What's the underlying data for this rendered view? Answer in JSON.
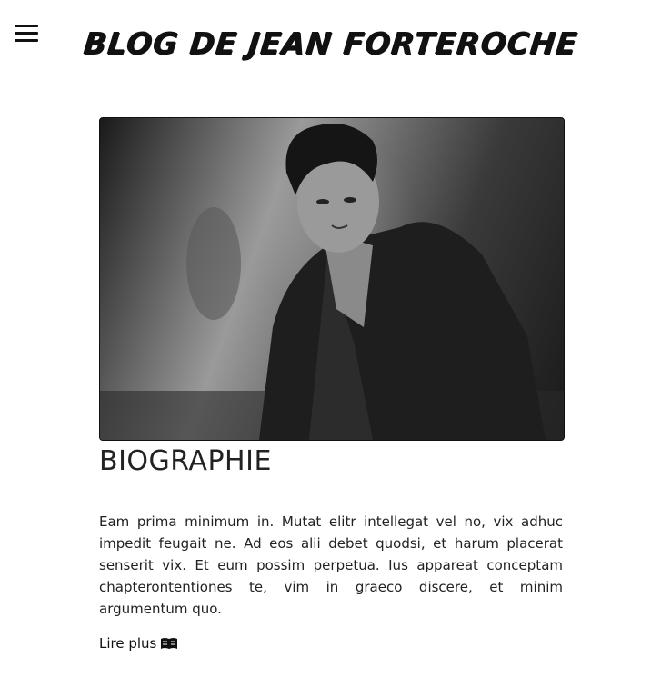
{
  "header": {
    "menu_icon": "hamburger-menu-icon",
    "title": "Blog de Jean Forteroche"
  },
  "post": {
    "image_alt": "Portrait noir et blanc",
    "title": "BIOGRAPHIE",
    "excerpt": "Eam prima minimum in. Mutat elitr intellegat vel no, vix adhuc impedit feugait ne. Ad eos alii debet quodsi, et harum placerat senserit vix. Et eum possim perpetua. Ius appareat conceptam chapterontentiones te, vim in graeco discere, et minim argumentum quo.",
    "read_more_label": "Lire plus",
    "read_more_icon": "open-book-icon"
  }
}
